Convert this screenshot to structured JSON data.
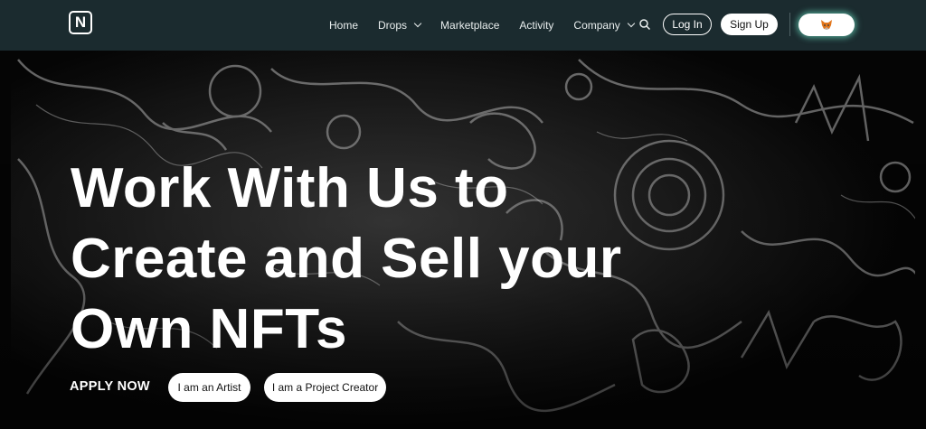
{
  "header": {
    "logo_letter": "N",
    "nav": [
      {
        "label": "Home",
        "has_dropdown": false
      },
      {
        "label": "Drops",
        "has_dropdown": true
      },
      {
        "label": "Marketplace",
        "has_dropdown": false
      },
      {
        "label": "Activity",
        "has_dropdown": false
      },
      {
        "label": "Company",
        "has_dropdown": true
      }
    ],
    "search_icon": "search-icon",
    "login_label": "Log In",
    "signup_label": "Sign Up",
    "wallet_icon": "metamask-fox-icon",
    "wallet_glow_color": "#78ffdc"
  },
  "hero": {
    "title_lines": [
      "Work With Us to",
      "Create and Sell your",
      "Own NFTs"
    ],
    "apply_label": "APPLY NOW",
    "buttons": [
      "I am an Artist",
      "I am a Project Creator"
    ]
  },
  "colors": {
    "header_bg": "#1b2b2f",
    "hero_bg": "#0b0b0b",
    "text": "#ffffff"
  }
}
